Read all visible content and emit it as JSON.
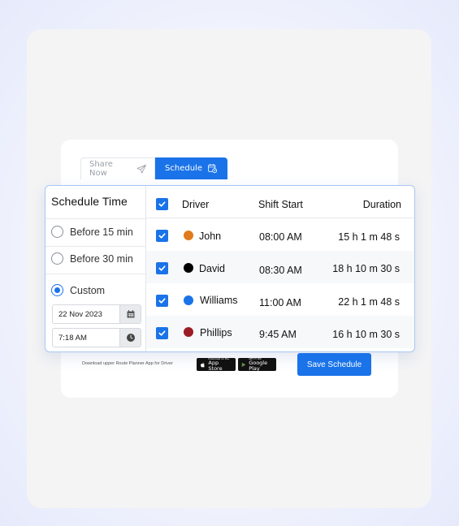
{
  "tabs": {
    "share_now": "Share Now",
    "schedule": "Schedule"
  },
  "schedule_time": {
    "title": "Schedule Time",
    "options": [
      {
        "label": "Before 15 min",
        "selected": false
      },
      {
        "label": "Before 30 min",
        "selected": false
      },
      {
        "label": "Custom",
        "selected": true
      }
    ],
    "custom_date": "22 Nov 2023",
    "custom_time": "7:18 AM"
  },
  "table": {
    "headers": {
      "driver": "Driver",
      "shift_start": "Shift Start",
      "duration": "Duration"
    },
    "rows": [
      {
        "driver": "John",
        "shift_start": "08:00 AM",
        "duration": "15 h 1 m 48 s",
        "color": "#e07b1c",
        "checked": true
      },
      {
        "driver": "David",
        "shift_start": "08:30 AM",
        "duration": "18 h 10 m 30 s",
        "color": "#000000",
        "checked": true
      },
      {
        "driver": "Williams",
        "shift_start": "11:00 AM",
        "duration": "22 h 1 m 48 s",
        "color": "#1a73e8",
        "checked": true
      },
      {
        "driver": "Phillips",
        "shift_start": "9:45 AM",
        "duration": "16 h 10 m 30 s",
        "color": "#9b1c24",
        "checked": true
      }
    ]
  },
  "footer": {
    "note": "Download upper Route Planner App for Driver",
    "app_store_small": "Download on the",
    "app_store": "App Store",
    "google_play_small": "GET IT ON",
    "google_play": "Google Play",
    "save_button": "Save Schedule"
  },
  "colors": {
    "accent": "#1a73e8",
    "panel_border": "#a9c6f5"
  },
  "icons": {
    "share": "paper-plane-icon",
    "schedule": "calendar-clock-icon",
    "date": "calendar-icon",
    "time": "clock-icon",
    "apple": "apple-icon",
    "play": "play-store-icon"
  }
}
